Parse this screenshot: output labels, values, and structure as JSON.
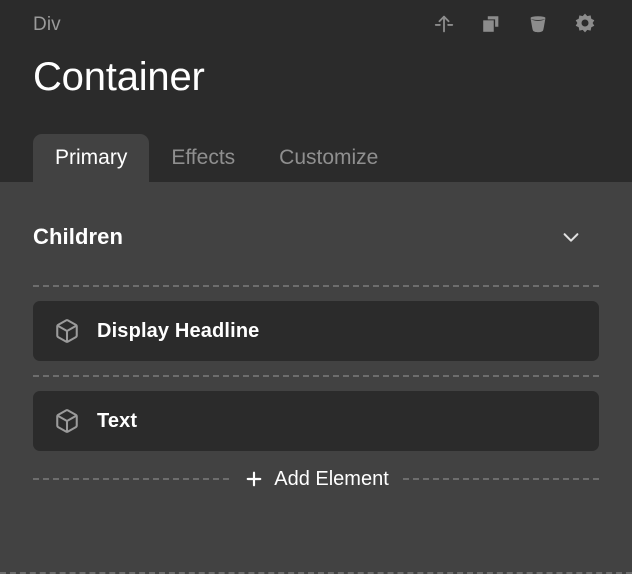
{
  "header": {
    "breadcrumb": "Div",
    "title": "Container",
    "actions": [
      {
        "name": "insert-above-icon",
        "label": "Insert Above"
      },
      {
        "name": "duplicate-icon",
        "label": "Duplicate"
      },
      {
        "name": "trash-icon",
        "label": "Delete"
      },
      {
        "name": "gear-icon",
        "label": "Settings"
      }
    ]
  },
  "tabs": [
    {
      "label": "Primary",
      "active": true
    },
    {
      "label": "Effects",
      "active": false
    },
    {
      "label": "Customize",
      "active": false
    }
  ],
  "children_section": {
    "title": "Children",
    "collapse_icon": "chevron-down-icon",
    "items": [
      {
        "label": "Display Headline",
        "icon": "cube-icon"
      },
      {
        "label": "Text",
        "icon": "cube-icon"
      }
    ],
    "add_element": {
      "label": "Add Element",
      "icon": "plus-icon"
    }
  },
  "colors": {
    "header_background": "#2b2b2b",
    "content_background": "#424242",
    "item_background": "#2b2b2b",
    "text_primary": "#ffffff",
    "text_muted": "#8f8f8f",
    "icon_muted": "#8c8c8c",
    "divider": "#6d6d6d"
  }
}
